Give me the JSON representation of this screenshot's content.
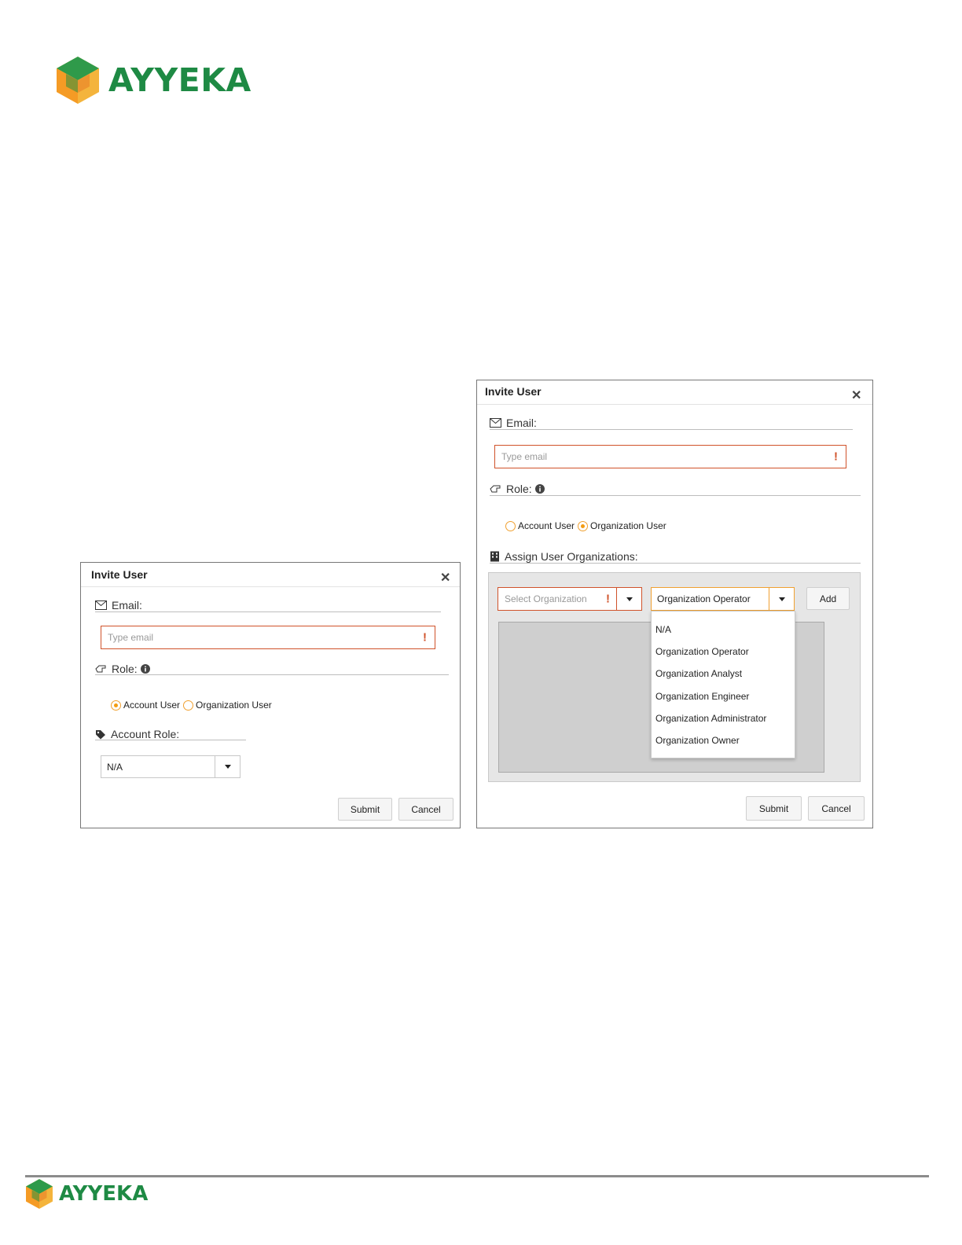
{
  "brand": {
    "name": "AYYEKA",
    "primary_color": "#1e8a44",
    "logo_icon": "hexagon-cube-logo"
  },
  "left_dialog": {
    "title": "Invite User",
    "close_icon": "close-icon",
    "email_label": "Email:",
    "email_placeholder": "Type email",
    "required_marker": "!",
    "role_label": "Role:",
    "role_options": [
      {
        "label": "Account User",
        "selected": true
      },
      {
        "label": "Organization User",
        "selected": false
      }
    ],
    "account_role_label": "Account Role:",
    "account_role_value": "N/A",
    "submit_label": "Submit",
    "cancel_label": "Cancel"
  },
  "right_dialog": {
    "title": "Invite User",
    "close_icon": "close-icon",
    "email_label": "Email:",
    "email_placeholder": "Type email",
    "required_marker": "!",
    "role_label": "Role:",
    "role_options": [
      {
        "label": "Account User",
        "selected": false
      },
      {
        "label": "Organization User",
        "selected": true
      }
    ],
    "assign_label": "Assign User Organizations:",
    "org_select_placeholder": "Select Organization",
    "role_select_value": "Organization Operator",
    "add_label": "Add",
    "role_dropdown_options": [
      "N/A",
      "Organization Operator",
      "Organization Analyst",
      "Organization Engineer",
      "Organization Administrator",
      "Organization Owner"
    ],
    "submit_label": "Submit",
    "cancel_label": "Cancel"
  },
  "colors": {
    "error_border": "#d0522a",
    "radio_accent": "#f39c12"
  }
}
